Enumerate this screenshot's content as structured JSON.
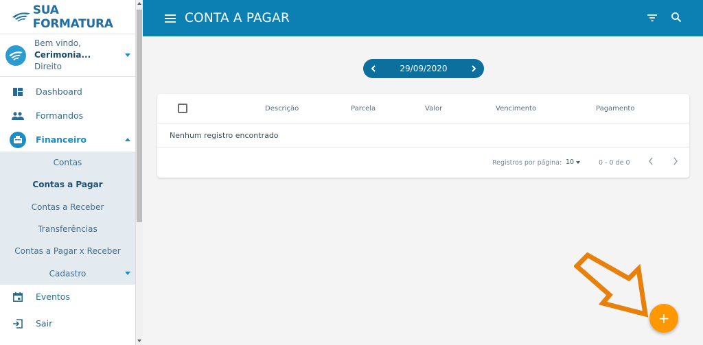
{
  "brand": {
    "logo_text": "SUA FORMATURA",
    "color": "#1e6fa3"
  },
  "user": {
    "greeting": "Bem vindo,",
    "name": "Cerimonia...",
    "course": "Direito"
  },
  "nav": {
    "dashboard": "Dashboard",
    "formandos": "Formandos",
    "financeiro": "Financeiro",
    "eventos": "Eventos",
    "sair": "Sair"
  },
  "submenu": {
    "contas": "Contas",
    "contas_a_pagar": "Contas a Pagar",
    "contas_a_receber": "Contas a Receber",
    "transferencias": "Transferências",
    "pagar_x_receber": "Contas a Pagar x Receber",
    "cadastro": "Cadastro"
  },
  "header": {
    "title": "CONTA A PAGAR",
    "color": "#0c80b3"
  },
  "date_nav": {
    "date": "29/09/2020"
  },
  "table": {
    "columns": [
      "Descrição",
      "Parcela",
      "Valor",
      "Vencimento",
      "Pagamento"
    ],
    "empty_message": "Nenhum registro encontrado",
    "rows_per_page_label": "Registros por página:",
    "rows_per_page_value": "10",
    "range": "0 - 0 de 0"
  },
  "fab": {
    "label": "+",
    "color": "#ff9800"
  },
  "annotation": {
    "color": "#e8810c"
  }
}
